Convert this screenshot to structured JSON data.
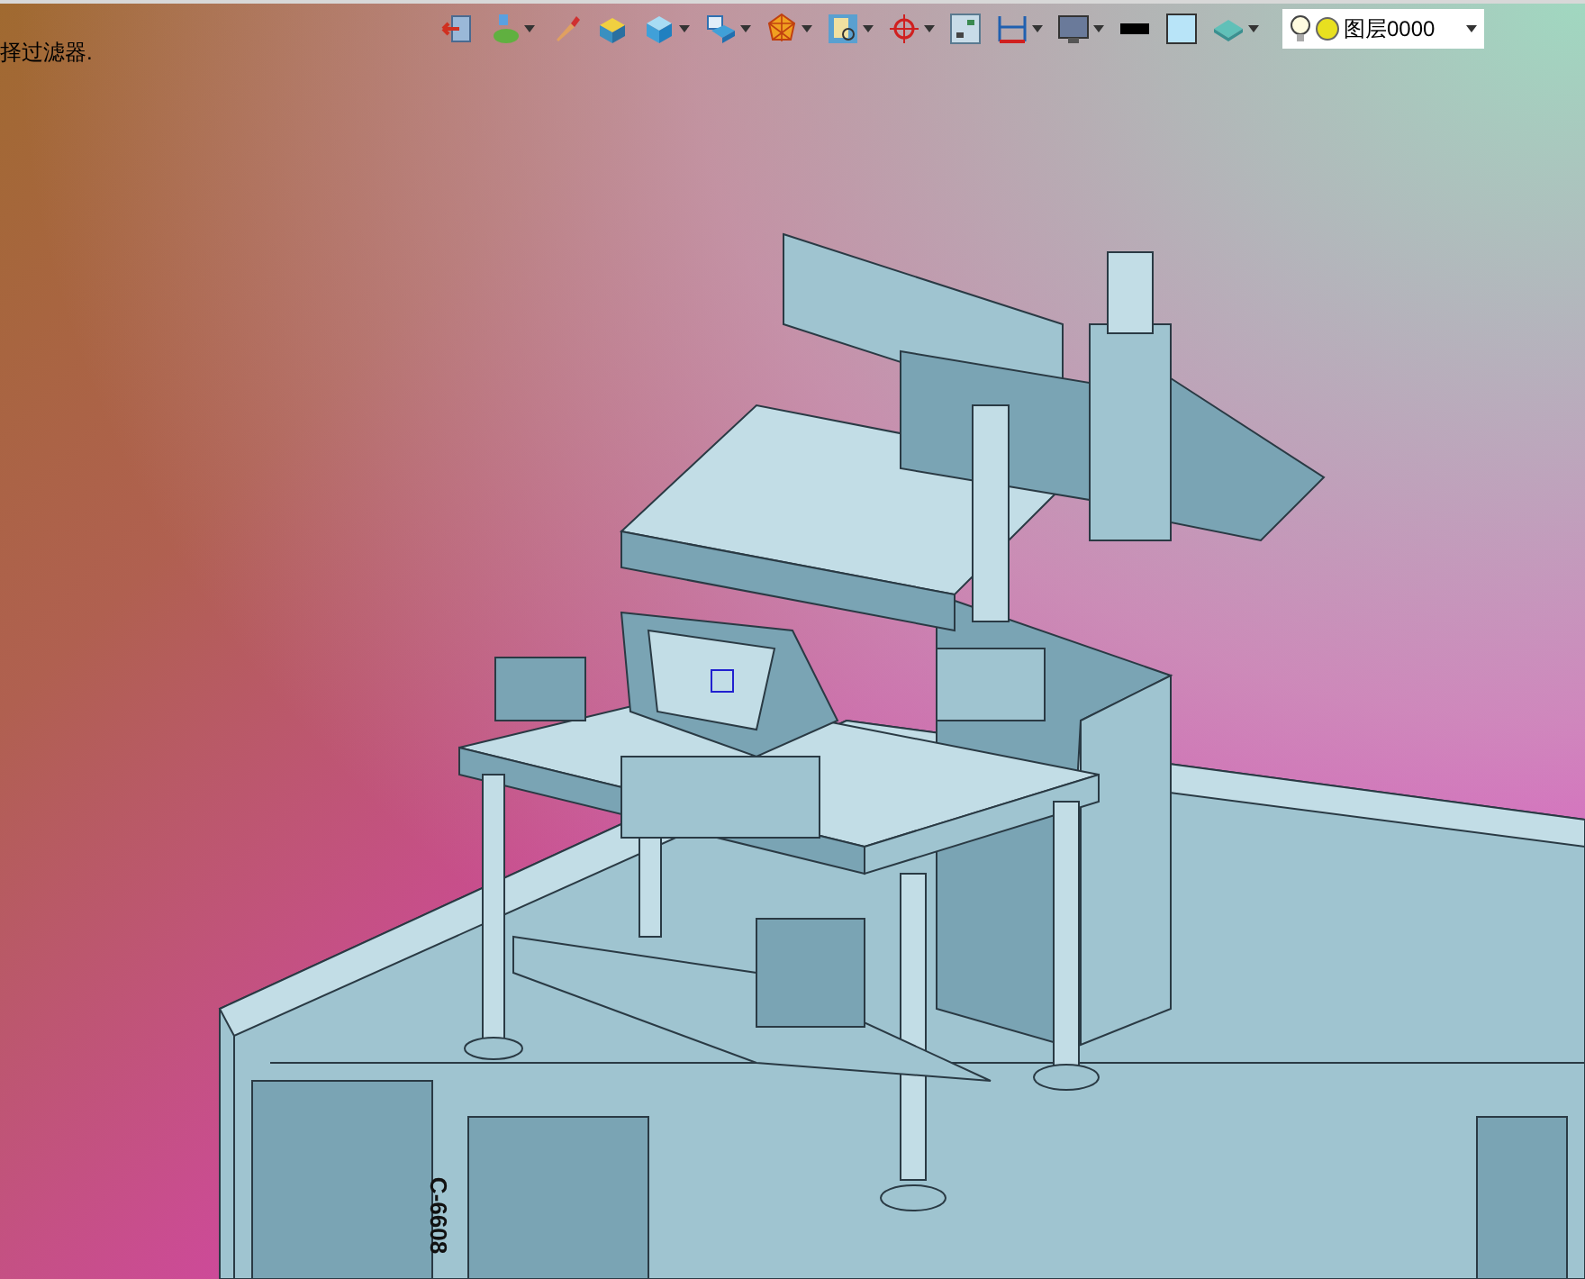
{
  "status_text": "择过滤器.",
  "toolbar": [
    {
      "kind": "exit",
      "has_menu": false
    },
    {
      "kind": "light",
      "has_menu": true
    },
    {
      "kind": "brush",
      "has_menu": false
    },
    {
      "kind": "box-yellow",
      "has_menu": false
    },
    {
      "kind": "box-blue",
      "has_menu": true
    },
    {
      "kind": "box-view",
      "has_menu": true
    },
    {
      "kind": "polygon",
      "has_menu": true
    },
    {
      "kind": "zoom",
      "has_menu": true
    },
    {
      "kind": "target",
      "has_menu": true
    },
    {
      "kind": "window",
      "has_menu": false
    },
    {
      "kind": "dimension",
      "has_menu": true
    },
    {
      "kind": "monitor",
      "has_menu": true
    },
    {
      "kind": "line",
      "has_menu": false
    },
    {
      "kind": "fill",
      "has_menu": false
    },
    {
      "kind": "layers",
      "has_menu": true
    }
  ],
  "layer_dropdown": {
    "value": "图层0000"
  },
  "model_label": "C-6608"
}
